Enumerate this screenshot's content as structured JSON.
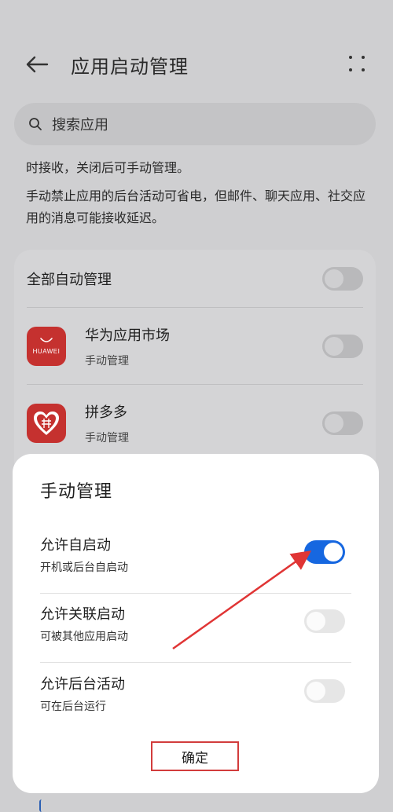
{
  "header": {
    "title": "应用启动管理"
  },
  "search": {
    "placeholder": "搜索应用"
  },
  "description": {
    "line1": "时接收，关闭后可手动管理。",
    "line2": "手动禁止应用的后台活动可省电，但邮件、聊天应用、社交应用的消息可能接收延迟。"
  },
  "list": {
    "all_label": "全部自动管理",
    "apps": [
      {
        "name": "华为应用市场",
        "status": "手动管理",
        "icon": "huawei-appgallery-icon",
        "brand": "HUAWEI",
        "enabled": false
      },
      {
        "name": "拼多多",
        "status": "手动管理",
        "icon": "pinduoduo-icon",
        "enabled": false
      }
    ]
  },
  "dialog": {
    "title": "手动管理",
    "options": [
      {
        "label": "允许自启动",
        "sub": "开机或后台自启动",
        "on": true
      },
      {
        "label": "允许关联启动",
        "sub": "可被其他应用启动",
        "on": false
      },
      {
        "label": "允许后台活动",
        "sub": "可在后台运行",
        "on": false
      }
    ],
    "confirm_label": "确定"
  },
  "colors": {
    "accent": "#1667e0",
    "annotation": "#d23c3c",
    "app_red": "#c5312f"
  }
}
